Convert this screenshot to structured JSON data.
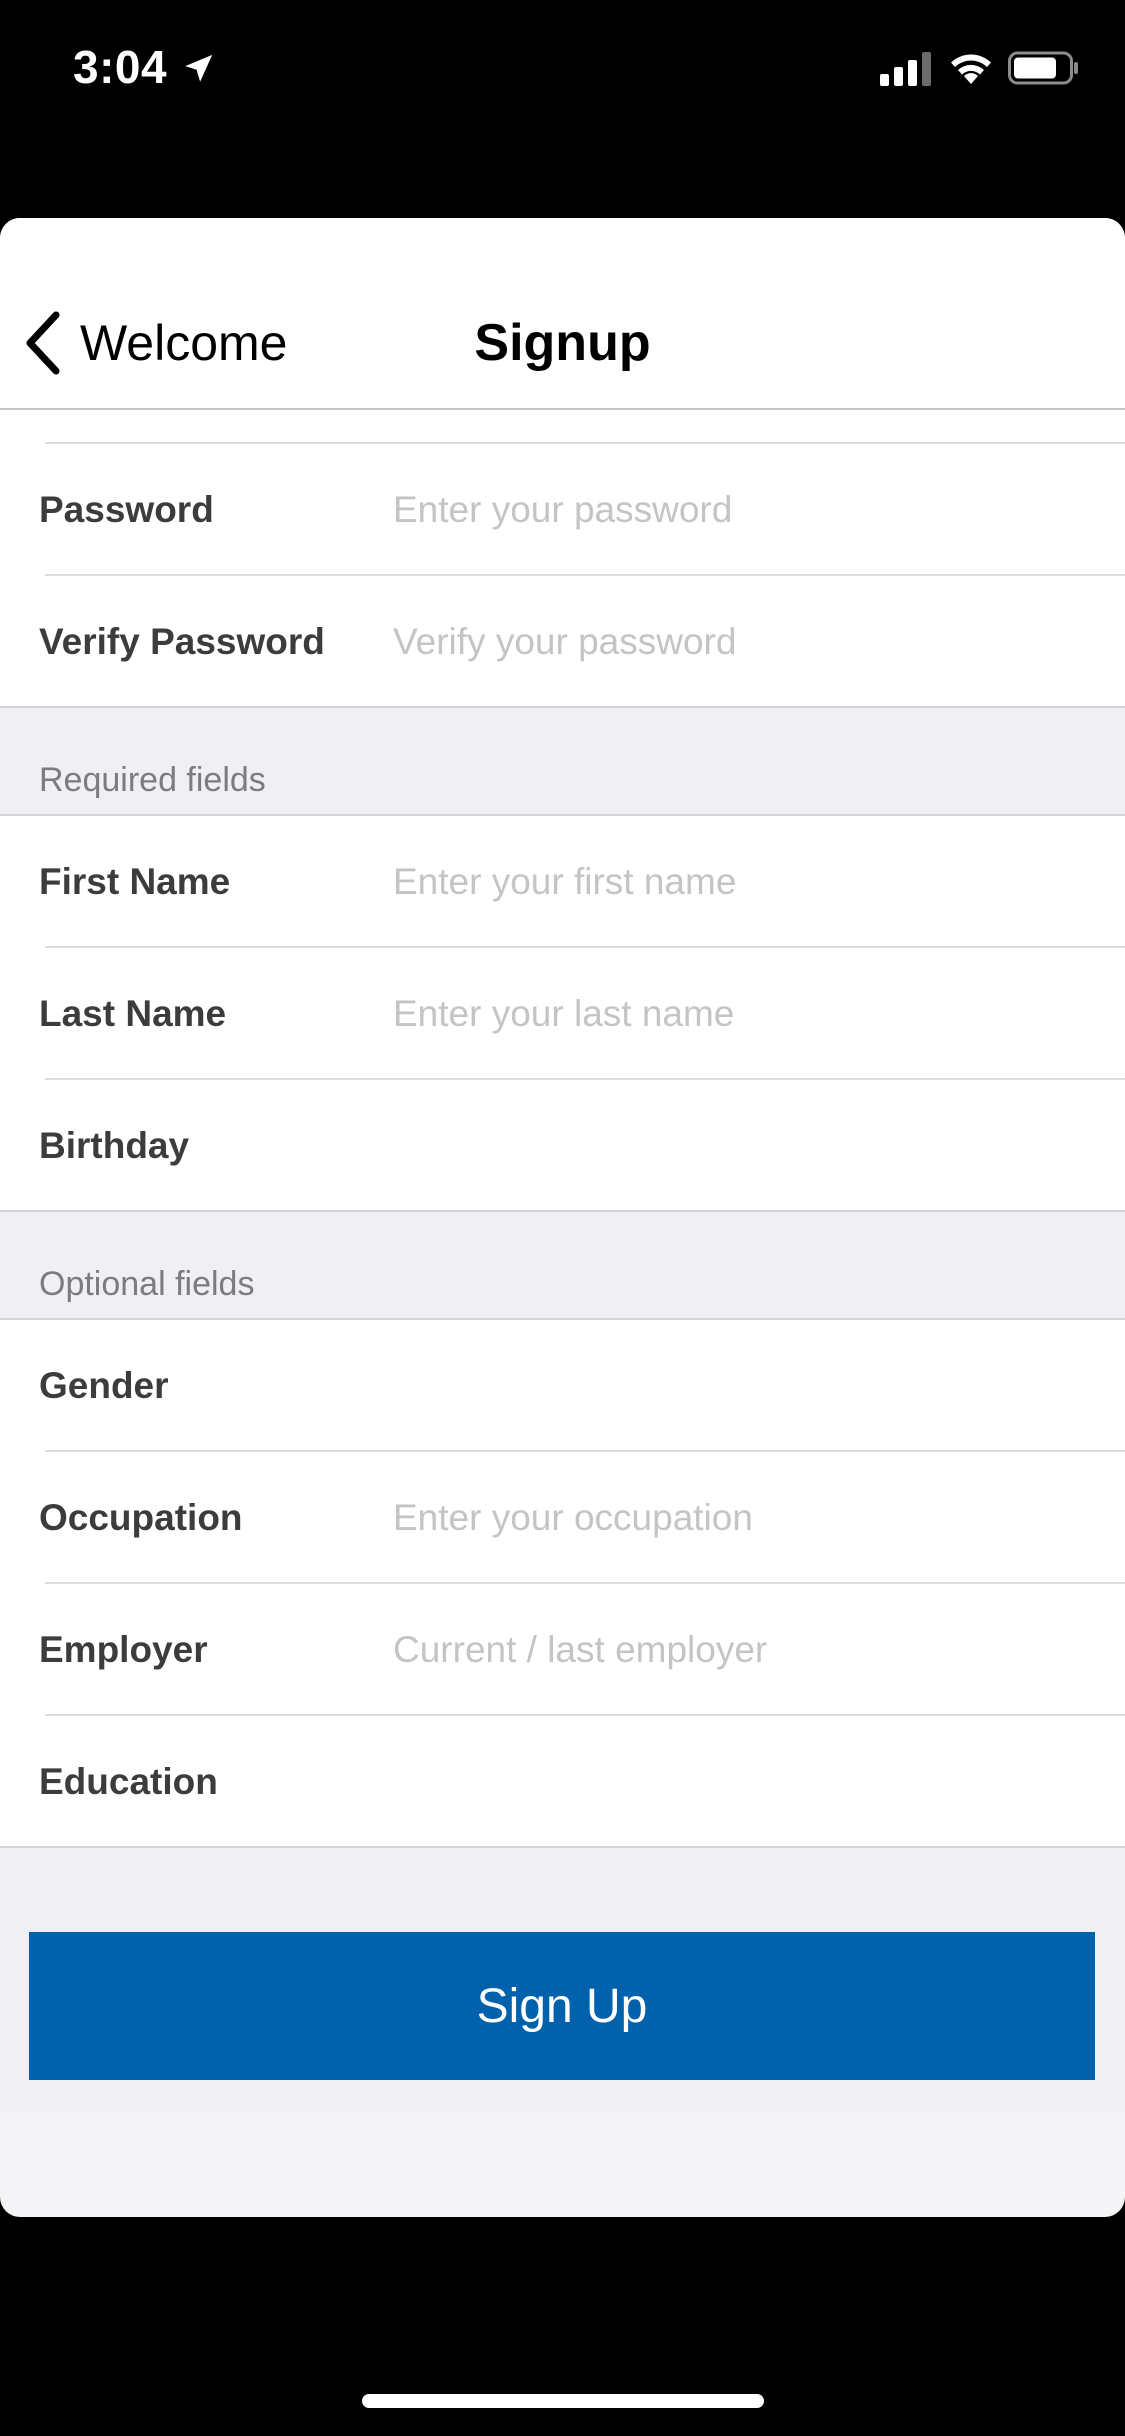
{
  "status_bar": {
    "time": "3:04"
  },
  "nav": {
    "back_label": "Welcome",
    "title": "Signup"
  },
  "account": {
    "rows": [
      {
        "label": "Password",
        "placeholder": "Enter your password"
      },
      {
        "label": "Verify Password",
        "placeholder": "Verify your password"
      }
    ]
  },
  "required": {
    "header": "Required fields",
    "rows": [
      {
        "label": "First Name",
        "placeholder": "Enter your first name"
      },
      {
        "label": "Last Name",
        "placeholder": "Enter your last name"
      },
      {
        "label": "Birthday"
      }
    ]
  },
  "optional": {
    "header": "Optional fields",
    "rows": [
      {
        "label": "Gender"
      },
      {
        "label": "Occupation",
        "placeholder": "Enter your occupation"
      },
      {
        "label": "Employer",
        "placeholder": "Current / last employer"
      },
      {
        "label": "Education"
      }
    ]
  },
  "submit": {
    "label": "Sign Up"
  },
  "colors": {
    "primary": "#0061ad",
    "group_bg": "#efeff4",
    "placeholder": "#c4c4c7"
  }
}
